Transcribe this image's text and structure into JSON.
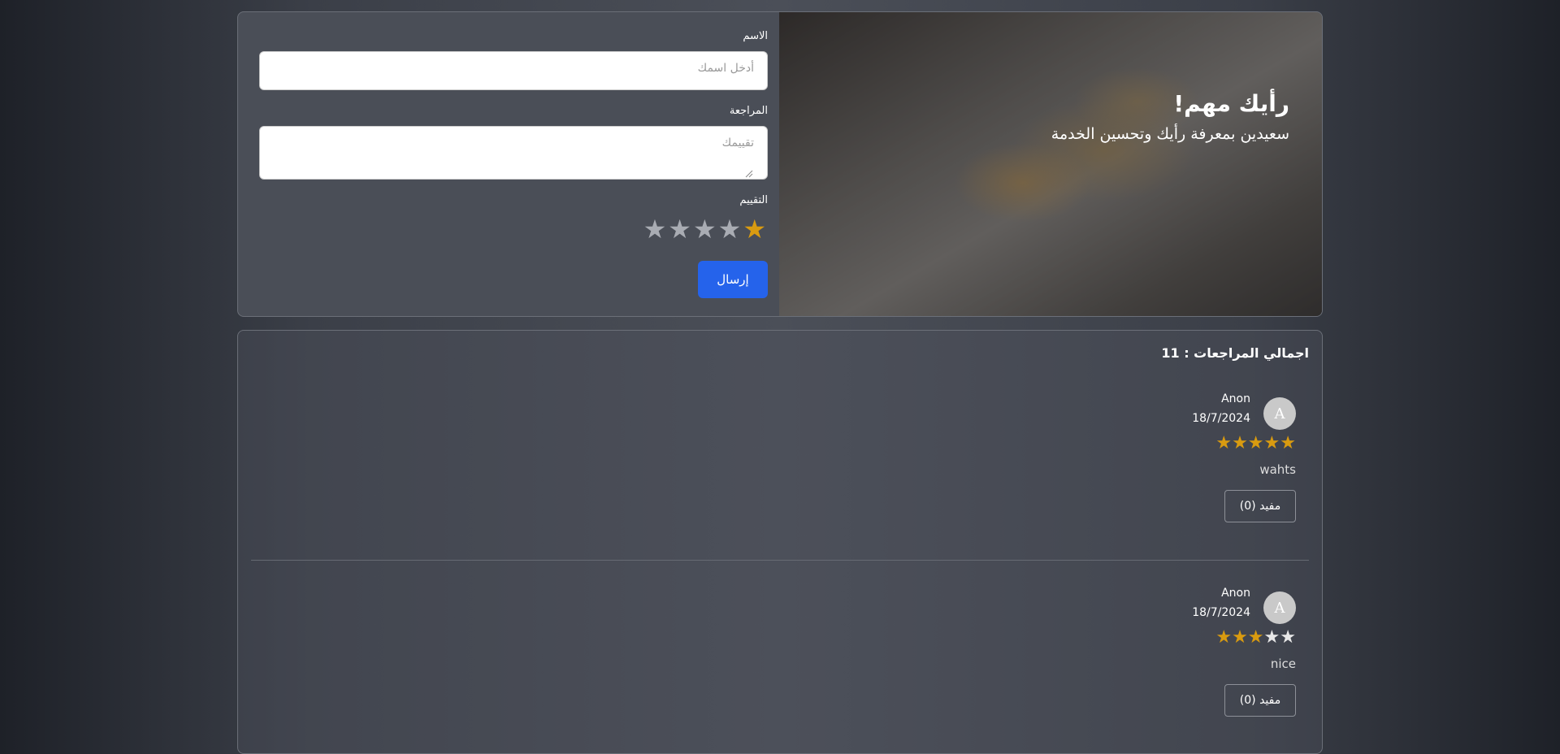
{
  "hero": {
    "title": "رأيك مهم!",
    "subtitle": "سعيدين بمعرفة رأيك وتحسين الخدمة"
  },
  "form": {
    "name_label": "الاسم",
    "name_placeholder": "أدخل اسمك",
    "review_label": "المراجعة",
    "review_placeholder": "تقييمك",
    "rating_label": "التقييم",
    "rating_value": 1,
    "rating_max": 5,
    "submit_label": "إرسال"
  },
  "reviews": {
    "total_label": "اجمالي المراجعات : 11",
    "items": [
      {
        "avatar": "A",
        "name": "Anon",
        "date": "18/7/2024",
        "rating": 5,
        "text": "wahts",
        "helpful_label": "مفيد (0)"
      },
      {
        "avatar": "A",
        "name": "Anon",
        "date": "18/7/2024",
        "rating": 3,
        "text": "nice",
        "helpful_label": "مفيد (0)"
      }
    ]
  },
  "colors": {
    "accent": "#2563eb",
    "star_on": "#d99b10",
    "star_off": "#a9acb3"
  },
  "icons": {
    "star": "star-icon",
    "resize": "resize-handle-icon"
  }
}
